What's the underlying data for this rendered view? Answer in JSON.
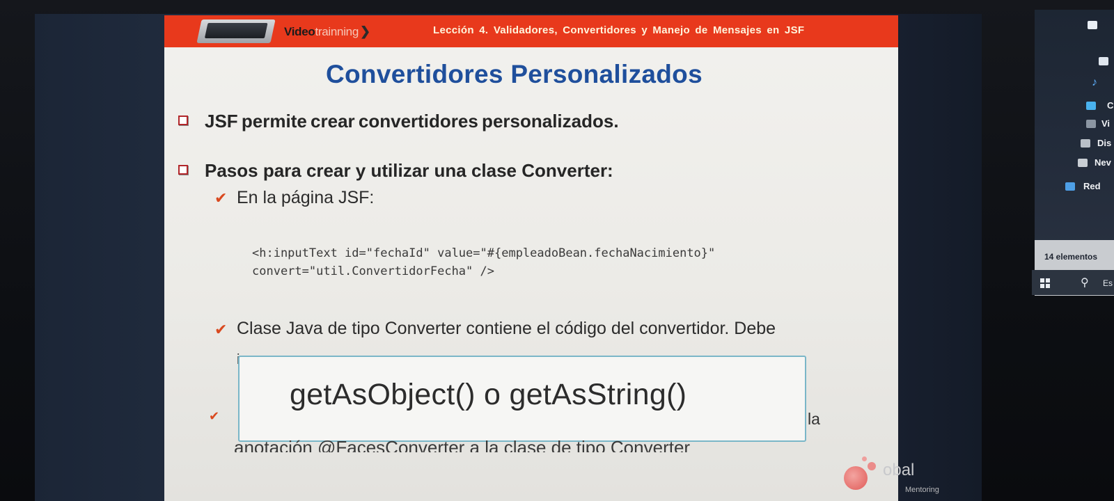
{
  "header": {
    "brand_part1": "Video",
    "brand_part2": "trainning",
    "lesson": "Lección 4. Validadores, Convertidores y Manejo de Mensajes en JSF"
  },
  "slide": {
    "title": "Convertidores Personalizados",
    "bullets": [
      {
        "text": "JSF permite crear convertidores personalizados."
      },
      {
        "text": "Pasos para crear y utilizar una clase Converter:"
      }
    ],
    "subitems": [
      {
        "text": "En la página JSF:"
      },
      {
        "text": "Clase Java de tipo Converter contiene el código del convertidor. Debe"
      }
    ],
    "code_lines": [
      "<h:inputText id=\"fechaId\" value=\"#{empleadoBean.fechaNacimiento}\"",
      "convert=\"util.ConvertidorFecha\" />"
    ],
    "overlay_text": "getAsObject() o getAsString()",
    "partial_right": "la",
    "partial_bottom": "anotación @FacesConverter a la clase de tipo Converter",
    "footer_logo_text": "obal",
    "footer_logo_sub": "Mentoring"
  },
  "side_window": {
    "items": [
      {
        "label": "C",
        "icon": "folder-icon"
      },
      {
        "label": "Vi",
        "icon": "video-icon"
      },
      {
        "label": "Dis",
        "icon": "disk-icon"
      },
      {
        "label": "Nev",
        "icon": "drive-icon"
      },
      {
        "label": "Red",
        "icon": "network-icon"
      }
    ],
    "count_text": "14 elementos",
    "search_text": "Es"
  },
  "colors": {
    "header_red": "#e8391c",
    "title_blue": "#1f4f9c",
    "bullet_red": "#b2262a",
    "check_orange": "#d9491f"
  }
}
